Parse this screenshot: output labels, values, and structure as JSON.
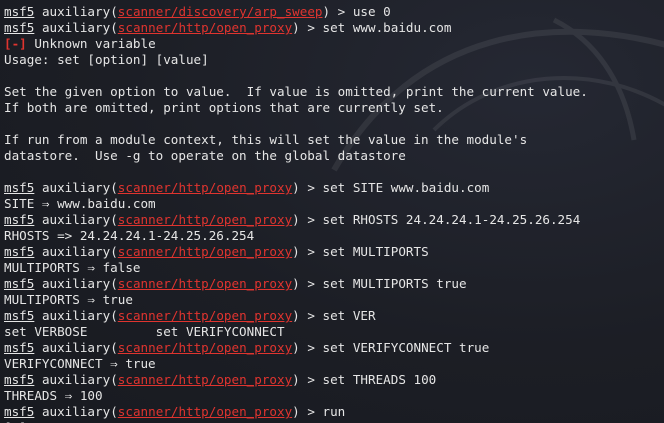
{
  "terminal": {
    "lines": [
      {
        "type": "prompt",
        "user": "msf5",
        "ctx": "auxiliary",
        "module": "scanner/discovery/arp_sweep",
        "cmd": "use 0"
      },
      {
        "type": "prompt",
        "user": "msf5",
        "ctx": "auxiliary",
        "module": "scanner/http/open_proxy",
        "cmd": "set www.baidu.com"
      },
      {
        "type": "error",
        "tag": "[-]",
        "text": " Unknown variable"
      },
      {
        "type": "text",
        "text": "Usage: set [option] [value]"
      },
      {
        "type": "text",
        "text": ""
      },
      {
        "type": "text",
        "text": "Set the given option to value.  If value is omitted, print the current value."
      },
      {
        "type": "text",
        "text": "If both are omitted, print options that are currently set."
      },
      {
        "type": "text",
        "text": ""
      },
      {
        "type": "text",
        "text": "If run from a module context, this will set the value in the module's"
      },
      {
        "type": "text",
        "text": "datastore.  Use -g to operate on the global datastore"
      },
      {
        "type": "text",
        "text": ""
      },
      {
        "type": "prompt",
        "user": "msf5",
        "ctx": "auxiliary",
        "module": "scanner/http/open_proxy",
        "cmd": "set SITE www.baidu.com"
      },
      {
        "type": "text",
        "text": "SITE ⇒ www.baidu.com"
      },
      {
        "type": "prompt",
        "user": "msf5",
        "ctx": "auxiliary",
        "module": "scanner/http/open_proxy",
        "cmd": "set RHOSTS 24.24.24.1-24.25.26.254"
      },
      {
        "type": "text",
        "text": "RHOSTS => 24.24.24.1-24.25.26.254"
      },
      {
        "type": "prompt",
        "user": "msf5",
        "ctx": "auxiliary",
        "module": "scanner/http/open_proxy",
        "cmd": "set MULTIPORTS"
      },
      {
        "type": "text",
        "text": "MULTIPORTS ⇒ false"
      },
      {
        "type": "prompt",
        "user": "msf5",
        "ctx": "auxiliary",
        "module": "scanner/http/open_proxy",
        "cmd": "set MULTIPORTS true"
      },
      {
        "type": "text",
        "text": "MULTIPORTS ⇒ true"
      },
      {
        "type": "prompt",
        "user": "msf5",
        "ctx": "auxiliary",
        "module": "scanner/http/open_proxy",
        "cmd": "set VER"
      },
      {
        "type": "text",
        "text": "set VERBOSE         set VERIFYCONNECT"
      },
      {
        "type": "prompt",
        "user": "msf5",
        "ctx": "auxiliary",
        "module": "scanner/http/open_proxy",
        "cmd": "set VERIFYCONNECT true"
      },
      {
        "type": "text",
        "text": "VERIFYCONNECT ⇒ true"
      },
      {
        "type": "prompt",
        "user": "msf5",
        "ctx": "auxiliary",
        "module": "scanner/http/open_proxy",
        "cmd": "set THREADS 100"
      },
      {
        "type": "text",
        "text": "THREADS ⇒ 100"
      },
      {
        "type": "prompt",
        "user": "msf5",
        "ctx": "auxiliary",
        "module": "scanner/http/open_proxy",
        "cmd": "run"
      },
      {
        "type": "text",
        "text": "[*]"
      }
    ]
  },
  "colors": {
    "background": "#1d1f26",
    "text": "#e6e6e6",
    "module": "#e0342f",
    "error": "#e0342f"
  }
}
